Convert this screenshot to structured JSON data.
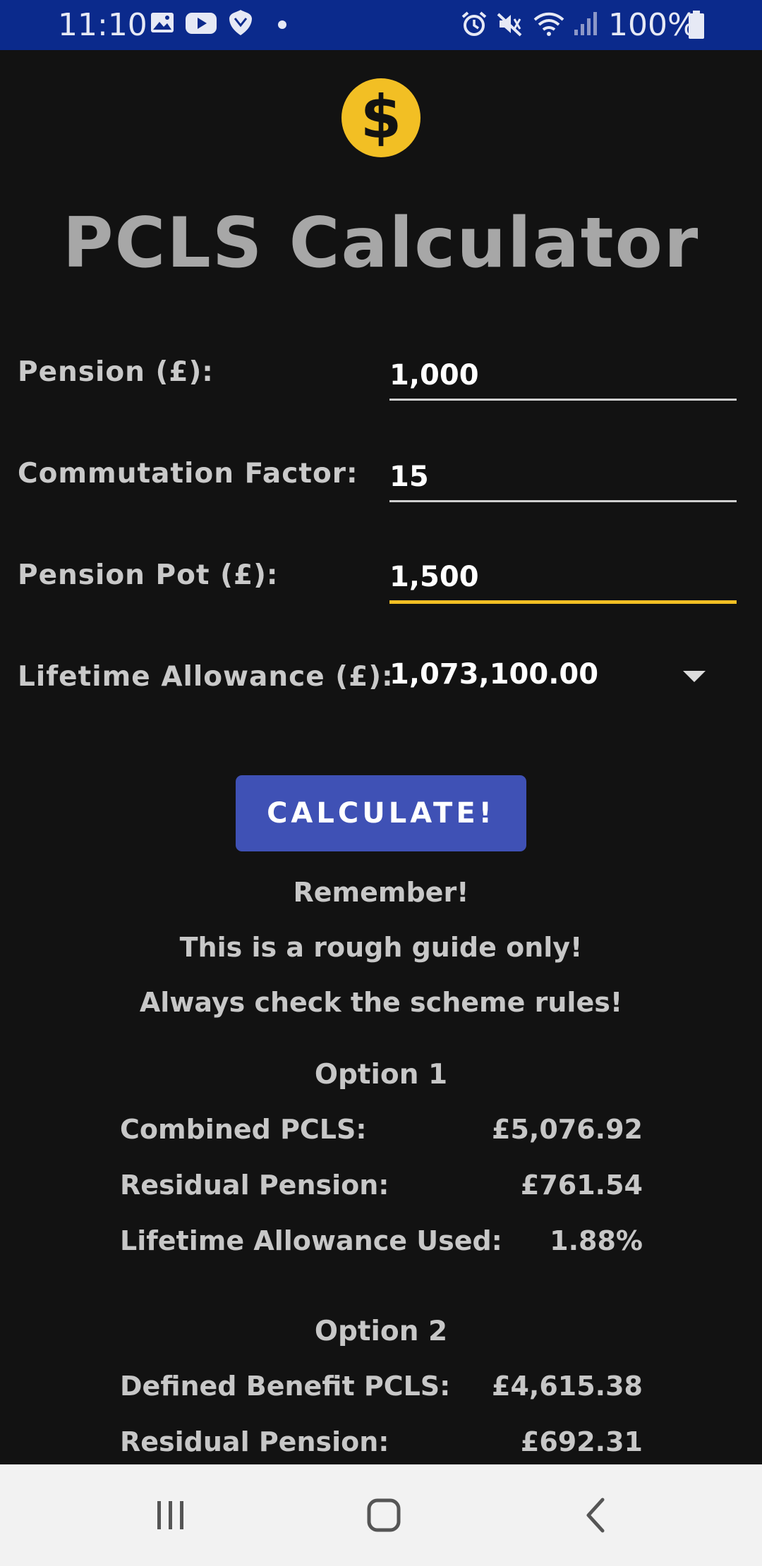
{
  "status_bar": {
    "time": "11:10",
    "battery": "100%",
    "icons": [
      "gallery-icon",
      "youtube-icon",
      "bank-icon",
      "dot-icon",
      "alarm-icon",
      "mute-icon",
      "wifi-icon",
      "signal-icon",
      "battery-icon"
    ]
  },
  "app": {
    "logo_icon": "dollar-coin-icon",
    "logo_color": "#f2bf24",
    "title": "PCLS Calculator"
  },
  "form": {
    "pension": {
      "label": "Pension (£):",
      "value": "1,000"
    },
    "commutation": {
      "label": "Commutation Factor:",
      "value": "15"
    },
    "pot": {
      "label": "Pension Pot (£):",
      "value": "1,500"
    },
    "lta": {
      "label": "Lifetime Allowance (£):",
      "value": "1,073,100.00"
    }
  },
  "calculate_label": "CALCULATE!",
  "notes": {
    "line1": "Remember!",
    "line2": "This is a rough guide only!",
    "line3": "Always check the scheme rules!"
  },
  "option1": {
    "title": "Option 1",
    "rows": [
      {
        "label": "Combined PCLS:",
        "value": "£5,076.92"
      },
      {
        "label": "Residual Pension:",
        "value": "£761.54"
      },
      {
        "label": "Lifetime Allowance Used:",
        "value": "1.88%"
      }
    ]
  },
  "option2": {
    "title": "Option 2",
    "rows": [
      {
        "label": "Defined Benefit PCLS:",
        "value": "£4,615.38"
      },
      {
        "label": "Residual Pension:",
        "value": "£692.31"
      }
    ]
  },
  "colors": {
    "status_bar": "#0b2a8c",
    "background": "#121212",
    "accent_button": "#3f51b5",
    "focus_underline": "#f2bf24"
  }
}
